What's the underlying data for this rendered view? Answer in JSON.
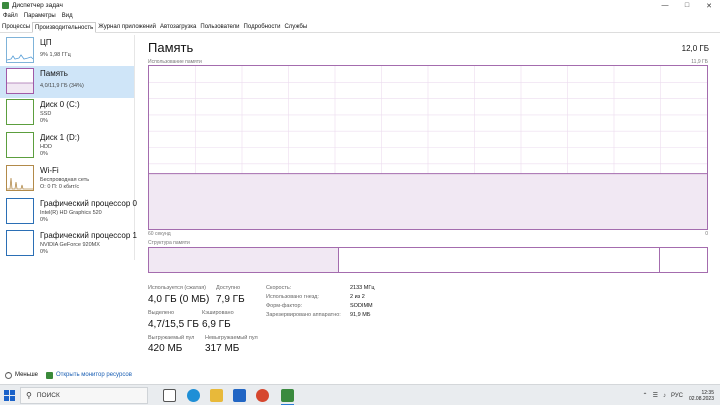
{
  "window": {
    "title": "Диспетчер задач",
    "icon": "task-manager-icon",
    "controls": [
      "—",
      "□",
      "✕"
    ]
  },
  "menu": [
    "Файл",
    "Параметры",
    "Вид"
  ],
  "tabs": [
    {
      "label": "Процессы",
      "active": false
    },
    {
      "label": "Производительность",
      "active": true
    },
    {
      "label": "Журнал приложений",
      "active": false
    },
    {
      "label": "Автозагрузка",
      "active": false
    },
    {
      "label": "Пользователи",
      "active": false
    },
    {
      "label": "Подробности",
      "active": false
    },
    {
      "label": "Службы",
      "active": false
    }
  ],
  "sidebar": {
    "items": [
      {
        "name": "ЦП",
        "sub1": "9% 1,98 ГГц",
        "sub2": "",
        "sub3": "",
        "selected": false
      },
      {
        "name": "Память",
        "sub1": "4,0/11,9 ГБ (34%)",
        "sub2": "",
        "sub3": "",
        "selected": true
      },
      {
        "name": "Диск 0 (C:)",
        "sub1": "SSD",
        "sub2": "0%",
        "sub3": "",
        "selected": false
      },
      {
        "name": "Диск 1 (D:)",
        "sub1": "HDD",
        "sub2": "0%",
        "sub3": "",
        "selected": false
      },
      {
        "name": "Wi-Fi",
        "sub1": "Беспроводная сеть",
        "sub2": "О: 0 П: 0 кбит/с",
        "sub3": "",
        "selected": false
      },
      {
        "name": "Графический процессор 0",
        "sub1": "Intel(R) HD Graphics 520",
        "sub2": "0%",
        "sub3": "",
        "selected": false
      },
      {
        "name": "Графический процессор 1",
        "sub1": "NVIDIA GeForce 920MX",
        "sub2": "0%",
        "sub3": "",
        "selected": false
      }
    ]
  },
  "main": {
    "title": "Память",
    "total": "12,0 ГБ",
    "graph_label": "Использование памяти",
    "graph_max": "11,9 ГБ",
    "time_left": "60 секунд",
    "time_right": "0",
    "usage_fraction": 0.34,
    "structure_label": "Структура памяти",
    "stats": {
      "in_use_label": "Используется (сжатая)",
      "in_use_value": "4,0 ГБ (0 МБ)",
      "available_label": "Доступно",
      "available_value": "7,9 ГБ",
      "committed_label": "Выделено",
      "committed_value": "4,7/15,5 ГБ",
      "cached_label": "Кэшировано",
      "cached_value": "6,9 ГБ",
      "paged_label": "Выгружаемый пул",
      "paged_value": "420 МБ",
      "nonpaged_label": "Невыгружаемый пул",
      "nonpaged_value": "317 МБ"
    },
    "details": {
      "speed_label": "Скорость:",
      "speed_value": "2133 МГц",
      "slots_label": "Использовано гнезд:",
      "slots_value": "2 из 2",
      "form_label": "Форм-фактор:",
      "form_value": "SODIMM",
      "reserved_label": "Зарезервировано аппаратно:",
      "reserved_value": "91,9 МБ"
    }
  },
  "bottom": {
    "less": "Меньше",
    "monitor": "Открыть монитор ресурсов"
  },
  "taskbar": {
    "search_placeholder": "ПОИСК",
    "language": "РУС",
    "time": "12:35",
    "date": "02.08.2023",
    "colors": {
      "accent": "#2a7bd4",
      "memory": "#a46cae",
      "memory_fill": "#f1e8f3"
    }
  }
}
